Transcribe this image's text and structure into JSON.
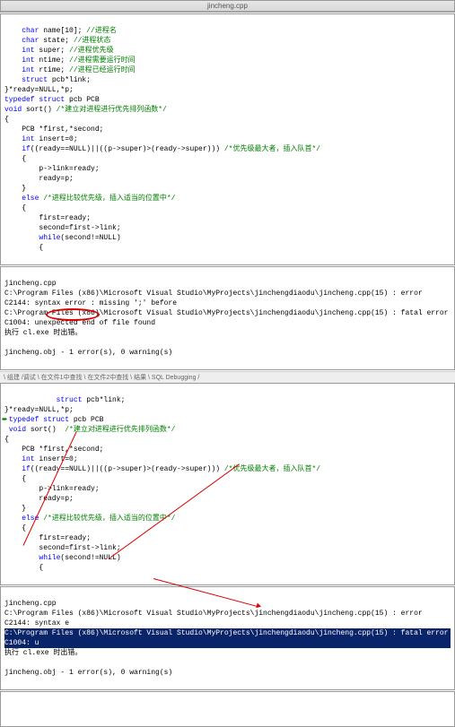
{
  "top_title": "jincheng.cpp",
  "code1": {
    "l1": {
      "kw": "char",
      "rest": " name[10]; ",
      "cm": "//进程名"
    },
    "l2": {
      "kw": "char",
      "rest": " state; ",
      "cm": "//进程状态"
    },
    "l3": {
      "kw": "int",
      "rest": " super; ",
      "cm": "//进程优先级"
    },
    "l4": {
      "kw": "int",
      "rest": " ntime; ",
      "cm": "//进程需要运行时间"
    },
    "l5": {
      "kw": "int",
      "rest": " rtime; ",
      "cm": "//进程已经运行时间"
    },
    "l6": {
      "kw": "struct",
      "rest": " pcb*link;"
    },
    "l7": "}*ready=NULL,*p;",
    "l8": {
      "kw": "typedef struct",
      "rest": " pcb PCB"
    },
    "l9": {
      "kw": "void",
      "rest": " sort() ",
      "cm": "/*建立对进程进行优先排列函数*/"
    },
    "l10": "{",
    "l11": "    PCB *first,*second;",
    "l12": {
      "kw": "    int",
      "rest": " insert=0;"
    },
    "l13": {
      "kw": "    if",
      "rest": "((ready==NULL)||((p->super)>(ready->super))) ",
      "cm": "/*优先级最大者，插入队首*/"
    },
    "l14": "    {",
    "l15": "        p->link=ready;",
    "l16": "        ready=p;",
    "l17": "    }",
    "l18": {
      "kw": "    else ",
      "cm": "/*进程比较优先级，插入适当的位置中*/"
    },
    "l19": "    {",
    "l20": "        first=ready;",
    "l21": "        second=first->link;",
    "l22": {
      "kw": "        while",
      "rest": "(second!=NULL)"
    },
    "l23": "        {"
  },
  "out1": {
    "title": "jincheng.cpp",
    "l1": "C:\\Program Files (x86)\\Microsoft Visual Studio\\MyProjects\\jinchengdiaodu\\jincheng.cpp(15) : error C2144: syntax error : missing ';' before",
    "l2": "C:\\Program Files (x86)\\Microsoft Visual Studio\\MyProjects\\jinchengdiaodu\\jincheng.cpp(15) : fatal error C1004: unexpected end of file found",
    "l3": "执行 cl.exe 时出错。",
    "l4": "jincheng.obj - 1 error(s), 0 warning(s)"
  },
  "tabs_text": "\\ 组建 /调试 \\ 在文件1中查找 \\ 在文件2中查找 \\ 结果 \\ SQL Debugging /",
  "code2": {
    "l1": {
      "kw": "            struct",
      "rest": " pcb*link;"
    },
    "l2": "}*ready=NULL,*p;",
    "l3": {
      "kw": "typedef struct",
      "rest": " pcb PCB"
    },
    "l4": {
      "kw": "void",
      "rest": " sort()  ",
      "cm": "/*建立对进程进行优先排列函数*/"
    },
    "l5": "{",
    "l6": "    PCB *first,*second;",
    "l7": {
      "kw": "    int",
      "rest": " insert=0;"
    },
    "l8": {
      "kw": "    if",
      "rest": "((ready==NULL)||((p->super)>(ready->super))) ",
      "cm": "/*优先级最大者，插入队首*/"
    },
    "l9": "    {",
    "l10": "        p->link=ready;",
    "l11": "        ready=p;",
    "l12": "    }",
    "l13": {
      "kw": "    else ",
      "cm": "/*进程比较优先级，插入适当的位置中*/"
    },
    "l14": "    {",
    "l15": "        first=ready;",
    "l16": "        second=first->link;",
    "l17": {
      "kw": "        while",
      "rest": "(second!=NULL)"
    },
    "l18": "        {"
  },
  "out2": {
    "title": "jincheng.cpp",
    "l1": "C:\\Program Files (x86)\\Microsoft Visual Studio\\MyProjects\\jinchengdiaodu\\jincheng.cpp(15) : error C2144: syntax e",
    "hl": "C:\\Program Files (x86)\\Microsoft Visual Studio\\MyProjects\\jinchengdiaodu\\jincheng.cpp(15) : fatal error C1004: u",
    "l3": "执行 cl.exe 时出错。",
    "l4": "jincheng.obj - 1 error(s), 0 warning(s)"
  }
}
